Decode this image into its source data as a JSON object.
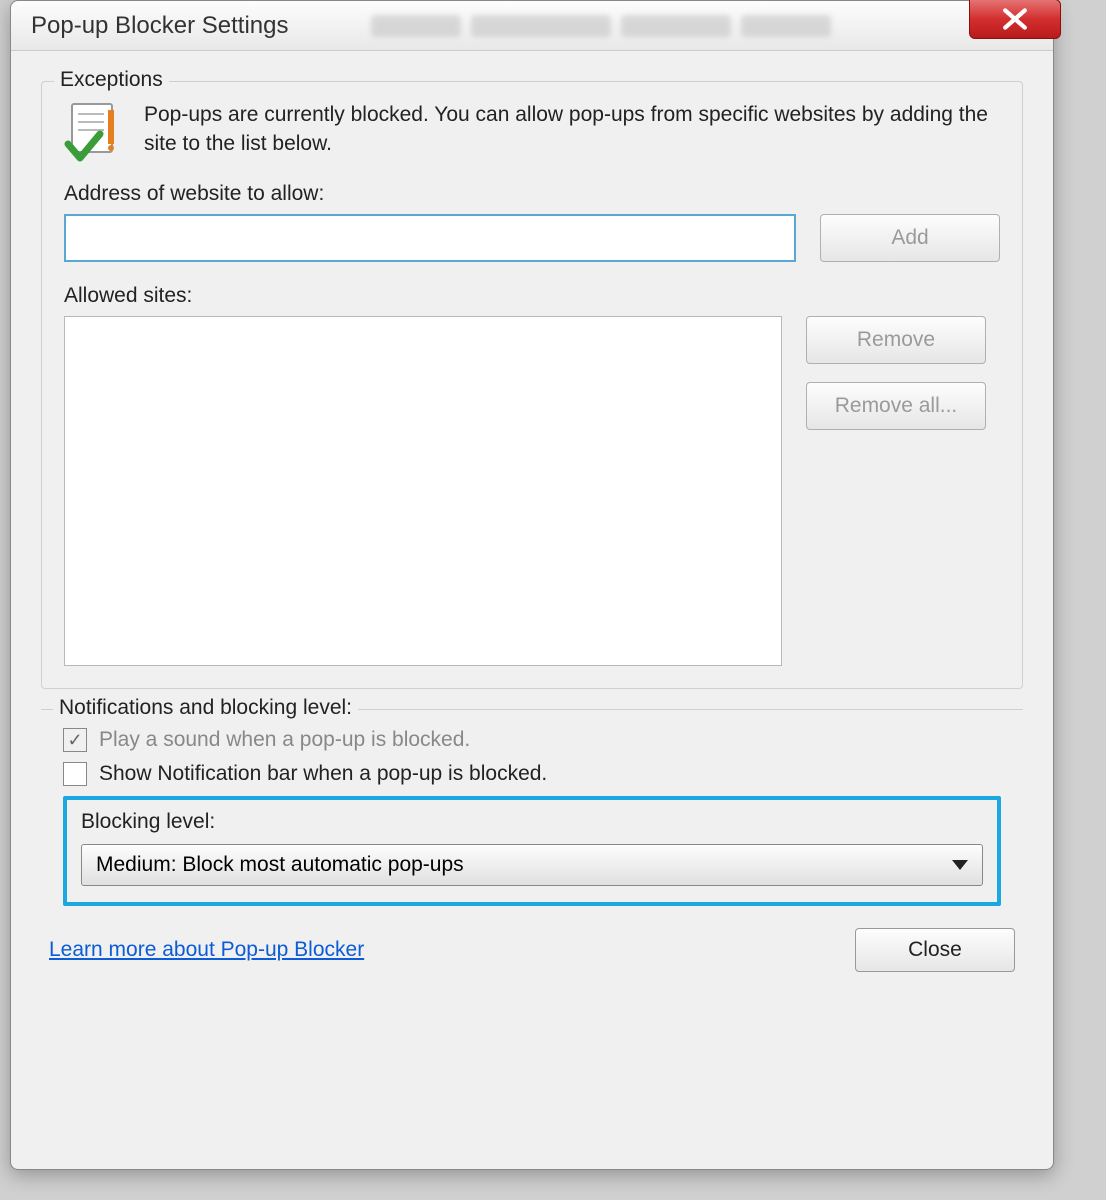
{
  "dialog": {
    "title": "Pop-up Blocker Settings"
  },
  "exceptions": {
    "group_title": "Exceptions",
    "info_text": "Pop-ups are currently blocked.  You can allow pop-ups from specific websites by adding the site to the list below.",
    "address_label": "Address of website to allow:",
    "address_value": "",
    "add_button": "Add",
    "allowed_label": "Allowed sites:",
    "remove_button": "Remove",
    "remove_all_button": "Remove all..."
  },
  "notifications": {
    "group_title": "Notifications and blocking level:",
    "play_sound_label": "Play a sound when a pop-up is blocked.",
    "play_sound_checked": true,
    "show_bar_label": "Show Notification bar when a pop-up is blocked.",
    "show_bar_checked": false,
    "blocking_label": "Blocking level:",
    "blocking_value": "Medium: Block most automatic pop-ups"
  },
  "footer": {
    "learn_more": "Learn more about Pop-up Blocker",
    "close": "Close"
  }
}
